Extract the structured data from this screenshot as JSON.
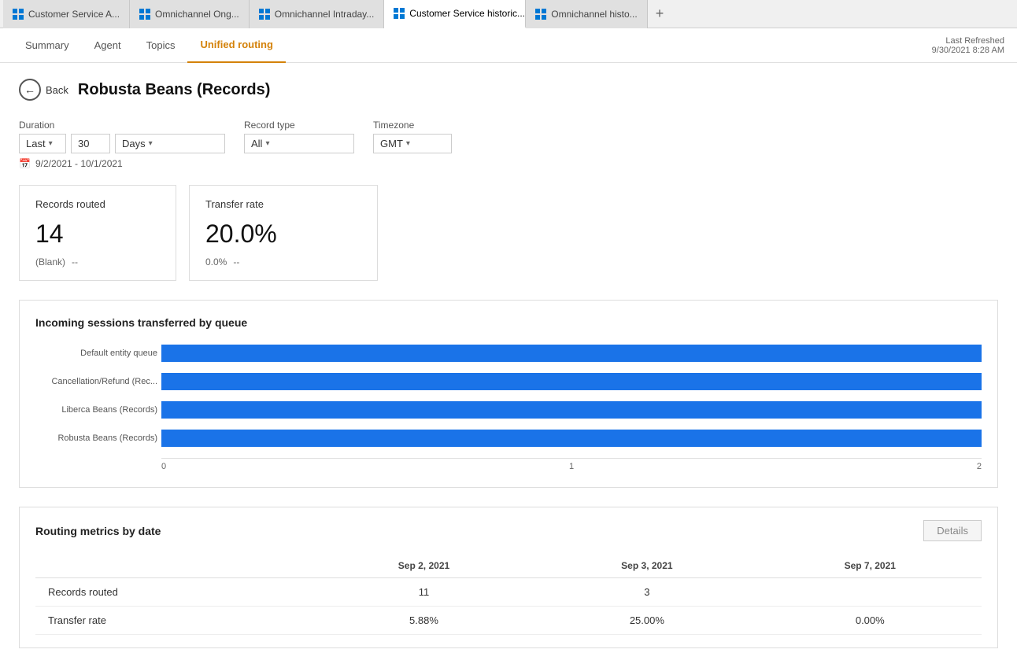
{
  "tabs": [
    {
      "id": "tab1",
      "label": "Customer Service A...",
      "icon": "grid-icon",
      "active": false,
      "closable": false
    },
    {
      "id": "tab2",
      "label": "Omnichannel Ong...",
      "icon": "grid-icon",
      "active": false,
      "closable": false
    },
    {
      "id": "tab3",
      "label": "Omnichannel Intraday...",
      "icon": "grid-icon",
      "active": false,
      "closable": false
    },
    {
      "id": "tab4",
      "label": "Customer Service historic...",
      "icon": "grid-icon",
      "active": true,
      "closable": true
    },
    {
      "id": "tab5",
      "label": "Omnichannel histo...",
      "icon": "grid-icon",
      "active": false,
      "closable": false
    }
  ],
  "nav": {
    "items": [
      {
        "id": "summary",
        "label": "Summary",
        "active": false
      },
      {
        "id": "agent",
        "label": "Agent",
        "active": false
      },
      {
        "id": "topics",
        "label": "Topics",
        "active": false
      },
      {
        "id": "unified",
        "label": "Unified routing",
        "active": true
      }
    ],
    "last_refreshed_label": "Last Refreshed",
    "last_refreshed_value": "9/30/2021 8:28 AM"
  },
  "page": {
    "back_label": "Back",
    "title": "Robusta Beans (Records)"
  },
  "filters": {
    "duration_label": "Duration",
    "duration_prefix": "Last",
    "duration_value": "30",
    "duration_unit": "Days",
    "record_type_label": "Record type",
    "record_type_value": "All",
    "timezone_label": "Timezone",
    "timezone_value": "GMT",
    "date_range": "9/2/2021 - 10/1/2021"
  },
  "cards": [
    {
      "title": "Records routed",
      "value": "14",
      "sub_label": "(Blank)",
      "sub_value": "--"
    },
    {
      "title": "Transfer rate",
      "value": "20.0%",
      "sub_label": "0.0%",
      "sub_value": "--"
    }
  ],
  "chart": {
    "title": "Incoming sessions transferred by queue",
    "bars": [
      {
        "label": "Default entity queue",
        "width_pct": 98
      },
      {
        "label": "Cancellation/Refund (Rec...",
        "width_pct": 60
      },
      {
        "label": "Liberca Beans (Records)",
        "width_pct": 60
      },
      {
        "label": "Robusta Beans (Records)",
        "width_pct": 60
      }
    ],
    "axis_labels": [
      "0",
      "1",
      "2"
    ]
  },
  "metrics": {
    "title": "Routing metrics by date",
    "details_label": "Details",
    "columns": [
      "",
      "Sep 2, 2021",
      "Sep 3, 2021",
      "Sep 7, 2021"
    ],
    "rows": [
      {
        "label": "Records routed",
        "values": [
          "11",
          "3",
          ""
        ]
      },
      {
        "label": "Transfer rate",
        "values": [
          "5.88%",
          "25.00%",
          "0.00%"
        ]
      }
    ]
  }
}
